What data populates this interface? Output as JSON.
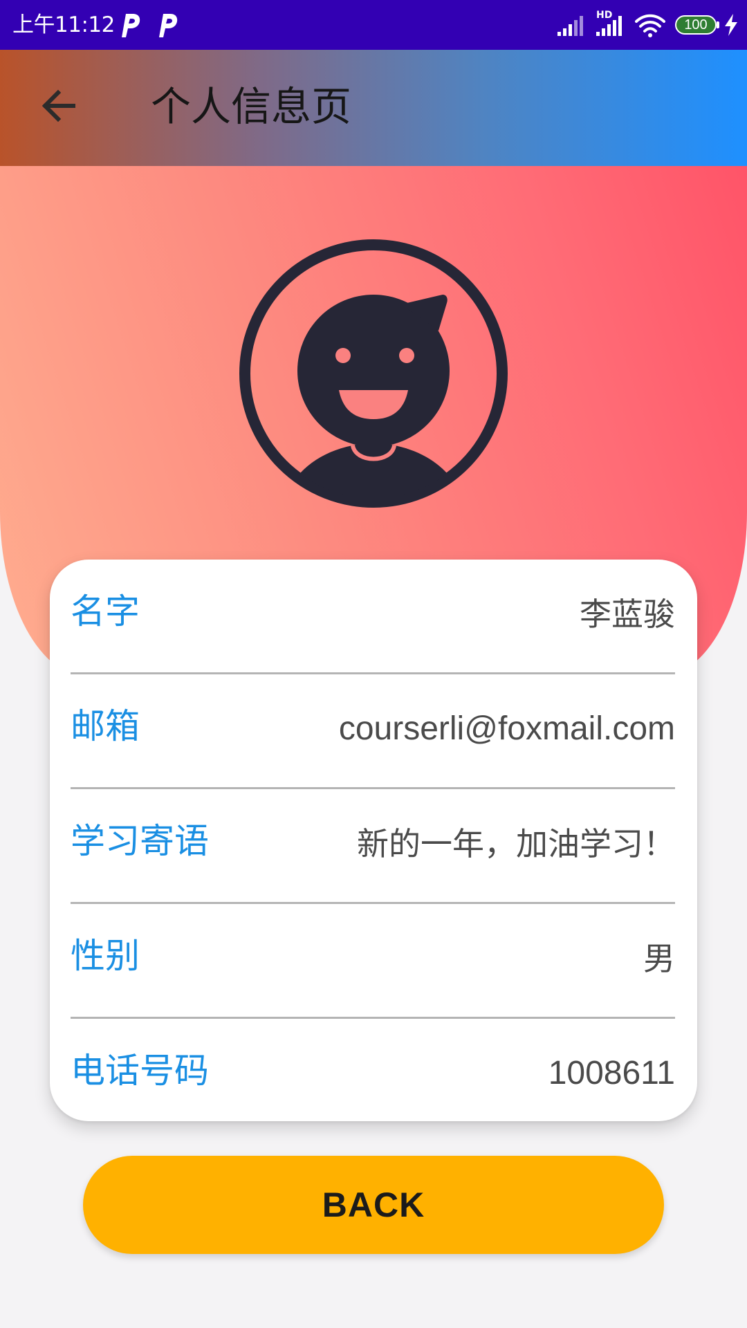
{
  "status_bar": {
    "time": "上午11:12",
    "app_icons": [
      "parking-p-icon",
      "parking-p-icon"
    ],
    "network_label": "HD",
    "battery_level": "100",
    "background_color": "#3300b3"
  },
  "app_bar": {
    "title": "个人信息页",
    "back_icon": "arrow-left-icon"
  },
  "profile": {
    "avatar_icon": "smiling-user-avatar-icon",
    "fields": [
      {
        "label": "名字",
        "value": "李蓝骏"
      },
      {
        "label": "邮箱",
        "value": "courserli@foxmail.com"
      },
      {
        "label": "学习寄语",
        "value": "新的一年，加油学习！"
      },
      {
        "label": "性别",
        "value": "男"
      },
      {
        "label": "电话号码",
        "value": "1008611"
      }
    ]
  },
  "back_button": {
    "label": "BACK",
    "color": "#ffb100"
  },
  "colors": {
    "label_blue": "#1a8fe3",
    "value_gray": "#4a4a4a",
    "hero_gradient": [
      "#ffad8f",
      "#ff5468"
    ],
    "app_bar_gradient": [
      "#b9532a",
      "#1e90ff"
    ]
  }
}
